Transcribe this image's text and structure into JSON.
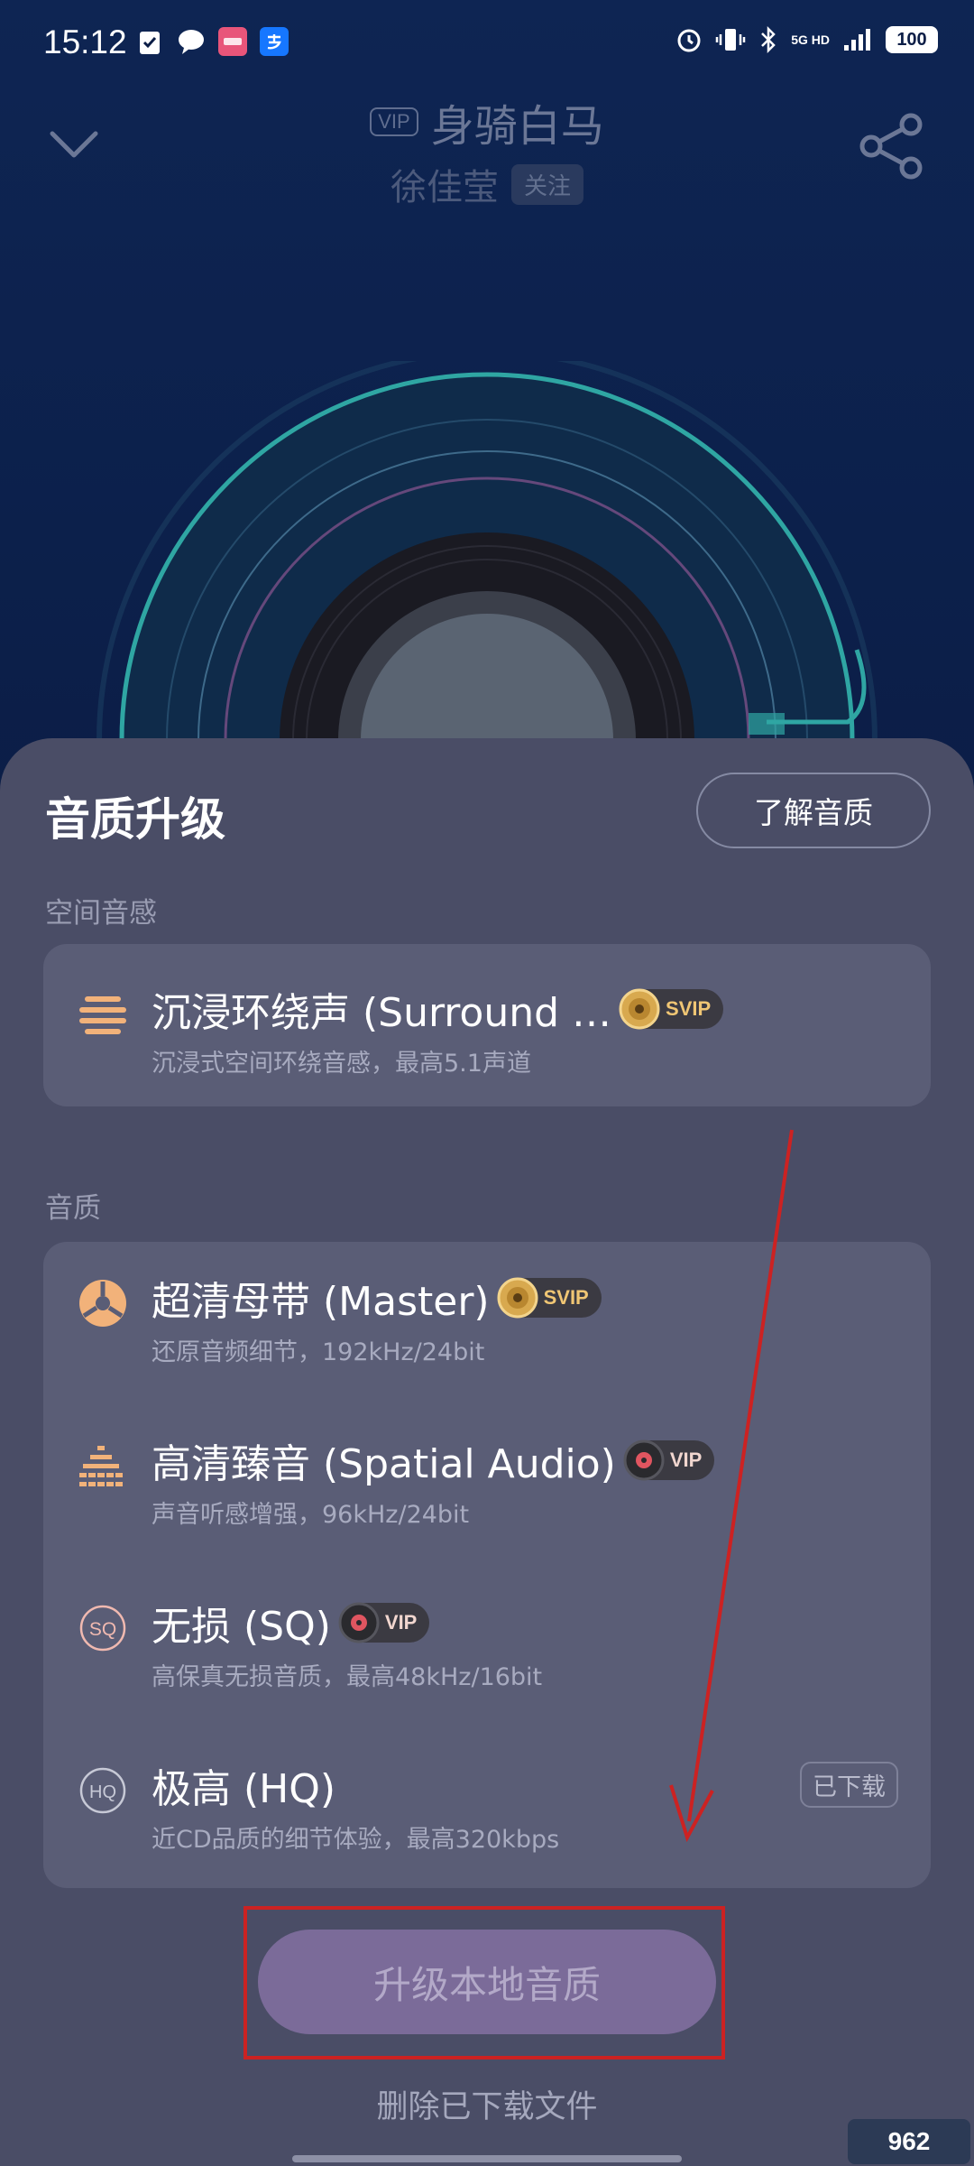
{
  "status_bar": {
    "time": "15:12",
    "network": "5G HD",
    "battery": "100"
  },
  "header": {
    "vip_tag": "VIP",
    "song_title": "身骑白马",
    "artist": "徐佳莹",
    "follow_label": "关注"
  },
  "sheet": {
    "title": "音质升级",
    "learn_button": "了解音质",
    "spatial_section": {
      "label": "空间音感",
      "options": [
        {
          "title": "沉浸环绕声 (Surround …",
          "subtitle": "沉浸式空间环绕音感，最高5.1声道",
          "badge": "SVIP",
          "icon": "surround-icon"
        }
      ]
    },
    "quality_section": {
      "label": "音质",
      "options": [
        {
          "title": "超清母带 (Master)",
          "subtitle": "还原音频细节，192kHz/24bit",
          "badge": "SVIP",
          "icon": "master-icon"
        },
        {
          "title": "高清臻音 (Spatial Audio)",
          "subtitle": "声音听感增强，96kHz/24bit",
          "badge": "VIP",
          "icon": "equalizer-icon"
        },
        {
          "title": "无损 (SQ)",
          "subtitle": "高保真无损音质，最高48kHz/16bit",
          "badge": "VIP",
          "icon": "sq-icon",
          "icon_text": "SQ"
        },
        {
          "title": "极高 (HQ)",
          "subtitle": "近CD品质的细节体验，最高320kbps",
          "status": "已下载",
          "icon": "hq-icon",
          "icon_text": "HQ"
        }
      ]
    },
    "upgrade_button": "升级本地音质",
    "delete_link": "删除已下载文件"
  },
  "watermark": "962",
  "colors": {
    "background": "#0b1d46",
    "sheet": "#4a4d66",
    "card": "#5a5d76",
    "svip_gold": "#f0c674",
    "vip_red": "#e05560",
    "button": "#7b6b99",
    "annotation_red": "#cc2222"
  }
}
